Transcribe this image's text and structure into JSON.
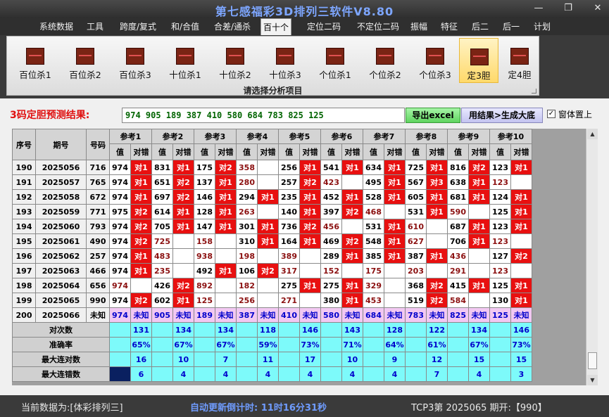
{
  "window": {
    "title": "第七感福彩3D排列三软件V8.80"
  },
  "menu": [
    "系统数据",
    "工具",
    "跨度/复式",
    "和/合值",
    "合差/通杀",
    "百十个",
    "定位二码",
    "不定位二码",
    "振幅",
    "特征",
    "后二",
    "后一",
    "计划"
  ],
  "ribbon": {
    "buttons": [
      "百位杀1",
      "百位杀2",
      "百位杀3",
      "十位杀1",
      "十位杀2",
      "十位杀3",
      "个位杀1",
      "个位杀2",
      "个位杀3",
      "定3胆",
      "定4胆"
    ],
    "group_label": "请选择分析项目"
  },
  "prediction": {
    "label": "3码定胆预测结果:",
    "value": "974 905 189 387 410 580 684 783 825 125",
    "excel_button": "导出excel",
    "generate_button": "用结果>生成大底",
    "checkbox_label": "窗体置上",
    "checkbox_checked": true
  },
  "table": {
    "headers": {
      "seq": "序号",
      "period": "期号",
      "code": "号码",
      "refs": [
        "参考1",
        "参考2",
        "参考3",
        "参考4",
        "参考5",
        "参考6",
        "参考7",
        "参考8",
        "参考9",
        "参考10"
      ],
      "value": "值",
      "check": "对错"
    },
    "rows": [
      {
        "seq": "190",
        "period": "2025056",
        "code": "716",
        "cells": [
          [
            "974",
            "对1"
          ],
          [
            "831",
            "对1"
          ],
          [
            "175",
            "对2"
          ],
          [
            "358",
            ""
          ],
          [
            "256",
            "对1"
          ],
          [
            "541",
            "对1"
          ],
          [
            "634",
            "对1"
          ],
          [
            "725",
            "对1"
          ],
          [
            "816",
            "对2"
          ],
          [
            "123",
            "对1"
          ]
        ]
      },
      {
        "seq": "191",
        "period": "2025057",
        "code": "765",
        "cells": [
          [
            "974",
            "对1"
          ],
          [
            "651",
            "对2"
          ],
          [
            "137",
            "对1"
          ],
          [
            "280",
            ""
          ],
          [
            "257",
            "对2"
          ],
          [
            "423",
            ""
          ],
          [
            "495",
            "对1"
          ],
          [
            "567",
            "对3"
          ],
          [
            "638",
            "对1"
          ],
          [
            "123",
            ""
          ]
        ]
      },
      {
        "seq": "192",
        "period": "2025058",
        "code": "672",
        "cells": [
          [
            "974",
            "对1"
          ],
          [
            "697",
            "对2"
          ],
          [
            "146",
            "对1"
          ],
          [
            "294",
            "对1"
          ],
          [
            "235",
            "对1"
          ],
          [
            "452",
            "对1"
          ],
          [
            "528",
            "对1"
          ],
          [
            "605",
            "对1"
          ],
          [
            "681",
            "对1"
          ],
          [
            "124",
            "对1"
          ]
        ]
      },
      {
        "seq": "193",
        "period": "2025059",
        "code": "771",
        "cells": [
          [
            "975",
            "对2"
          ],
          [
            "614",
            "对1"
          ],
          [
            "128",
            "对1"
          ],
          [
            "263",
            ""
          ],
          [
            "140",
            "对1"
          ],
          [
            "397",
            "对2"
          ],
          [
            "468",
            ""
          ],
          [
            "531",
            "对1"
          ],
          [
            "590",
            ""
          ],
          [
            "125",
            "对1"
          ]
        ]
      },
      {
        "seq": "194",
        "period": "2025060",
        "code": "793",
        "cells": [
          [
            "974",
            "对2"
          ],
          [
            "705",
            "对1"
          ],
          [
            "147",
            "对1"
          ],
          [
            "301",
            "对1"
          ],
          [
            "736",
            "对2"
          ],
          [
            "456",
            ""
          ],
          [
            "531",
            "对1"
          ],
          [
            "610",
            ""
          ],
          [
            "687",
            "对1"
          ],
          [
            "123",
            "对1"
          ]
        ]
      },
      {
        "seq": "195",
        "period": "2025061",
        "code": "490",
        "cells": [
          [
            "974",
            "对2"
          ],
          [
            "725",
            ""
          ],
          [
            "158",
            ""
          ],
          [
            "310",
            "对1"
          ],
          [
            "164",
            "对1"
          ],
          [
            "469",
            "对2"
          ],
          [
            "548",
            "对1"
          ],
          [
            "627",
            ""
          ],
          [
            "706",
            "对1"
          ],
          [
            "123",
            ""
          ]
        ]
      },
      {
        "seq": "196",
        "period": "2025062",
        "code": "257",
        "cells": [
          [
            "974",
            "对1"
          ],
          [
            "483",
            ""
          ],
          [
            "938",
            ""
          ],
          [
            "198",
            ""
          ],
          [
            "389",
            ""
          ],
          [
            "289",
            "对1"
          ],
          [
            "385",
            "对1"
          ],
          [
            "387",
            "对1"
          ],
          [
            "436",
            ""
          ],
          [
            "127",
            "对2"
          ]
        ]
      },
      {
        "seq": "197",
        "period": "2025063",
        "code": "466",
        "cells": [
          [
            "974",
            "对1"
          ],
          [
            "235",
            ""
          ],
          [
            "492",
            "对1"
          ],
          [
            "106",
            "对2"
          ],
          [
            "317",
            ""
          ],
          [
            "152",
            ""
          ],
          [
            "175",
            ""
          ],
          [
            "203",
            ""
          ],
          [
            "291",
            ""
          ],
          [
            "123",
            ""
          ]
        ]
      },
      {
        "seq": "198",
        "period": "2025064",
        "code": "656",
        "cells": [
          [
            "974",
            ""
          ],
          [
            "426",
            "对2"
          ],
          [
            "892",
            ""
          ],
          [
            "182",
            ""
          ],
          [
            "275",
            "对1"
          ],
          [
            "275",
            "对1"
          ],
          [
            "329",
            ""
          ],
          [
            "368",
            "对2"
          ],
          [
            "415",
            "对1"
          ],
          [
            "125",
            "对1"
          ]
        ]
      },
      {
        "seq": "199",
        "period": "2025065",
        "code": "990",
        "cells": [
          [
            "974",
            "对2"
          ],
          [
            "602",
            "对1"
          ],
          [
            "125",
            ""
          ],
          [
            "256",
            ""
          ],
          [
            "271",
            ""
          ],
          [
            "380",
            "对1"
          ],
          [
            "453",
            ""
          ],
          [
            "519",
            "对2"
          ],
          [
            "584",
            ""
          ],
          [
            "130",
            "对1"
          ]
        ]
      }
    ],
    "future": {
      "seq": "200",
      "period": "2025066",
      "code": "未知",
      "values": [
        "974",
        "905",
        "189",
        "387",
        "410",
        "580",
        "684",
        "783",
        "825",
        "125"
      ],
      "unknown": "未知"
    },
    "stats": [
      {
        "label": "对次数",
        "values": [
          "131",
          "134",
          "134",
          "118",
          "146",
          "143",
          "128",
          "122",
          "134",
          "146"
        ]
      },
      {
        "label": "准确率",
        "values": [
          "65%",
          "67%",
          "67%",
          "59%",
          "73%",
          "71%",
          "64%",
          "61%",
          "67%",
          "73%"
        ]
      },
      {
        "label": "最大连对数",
        "values": [
          "16",
          "10",
          "7",
          "11",
          "17",
          "10",
          "9",
          "12",
          "15",
          "15"
        ]
      },
      {
        "label": "最大连错数",
        "values": [
          "6",
          "4",
          "4",
          "4",
          "4",
          "4",
          "4",
          "7",
          "4",
          "3"
        ]
      }
    ]
  },
  "status": {
    "current": "当前数据为:[体彩排列三]",
    "countdown": "自动更新倒计时: 11时16分31秒",
    "draw": "TCP3第 2025065 期开:【990】"
  },
  "colors": {
    "hit": "#e81010",
    "miss_text": "#8b1010",
    "future_row": "#f2c8f2",
    "stats_row": "#7dfafa",
    "stats_text": "#0000cc"
  }
}
